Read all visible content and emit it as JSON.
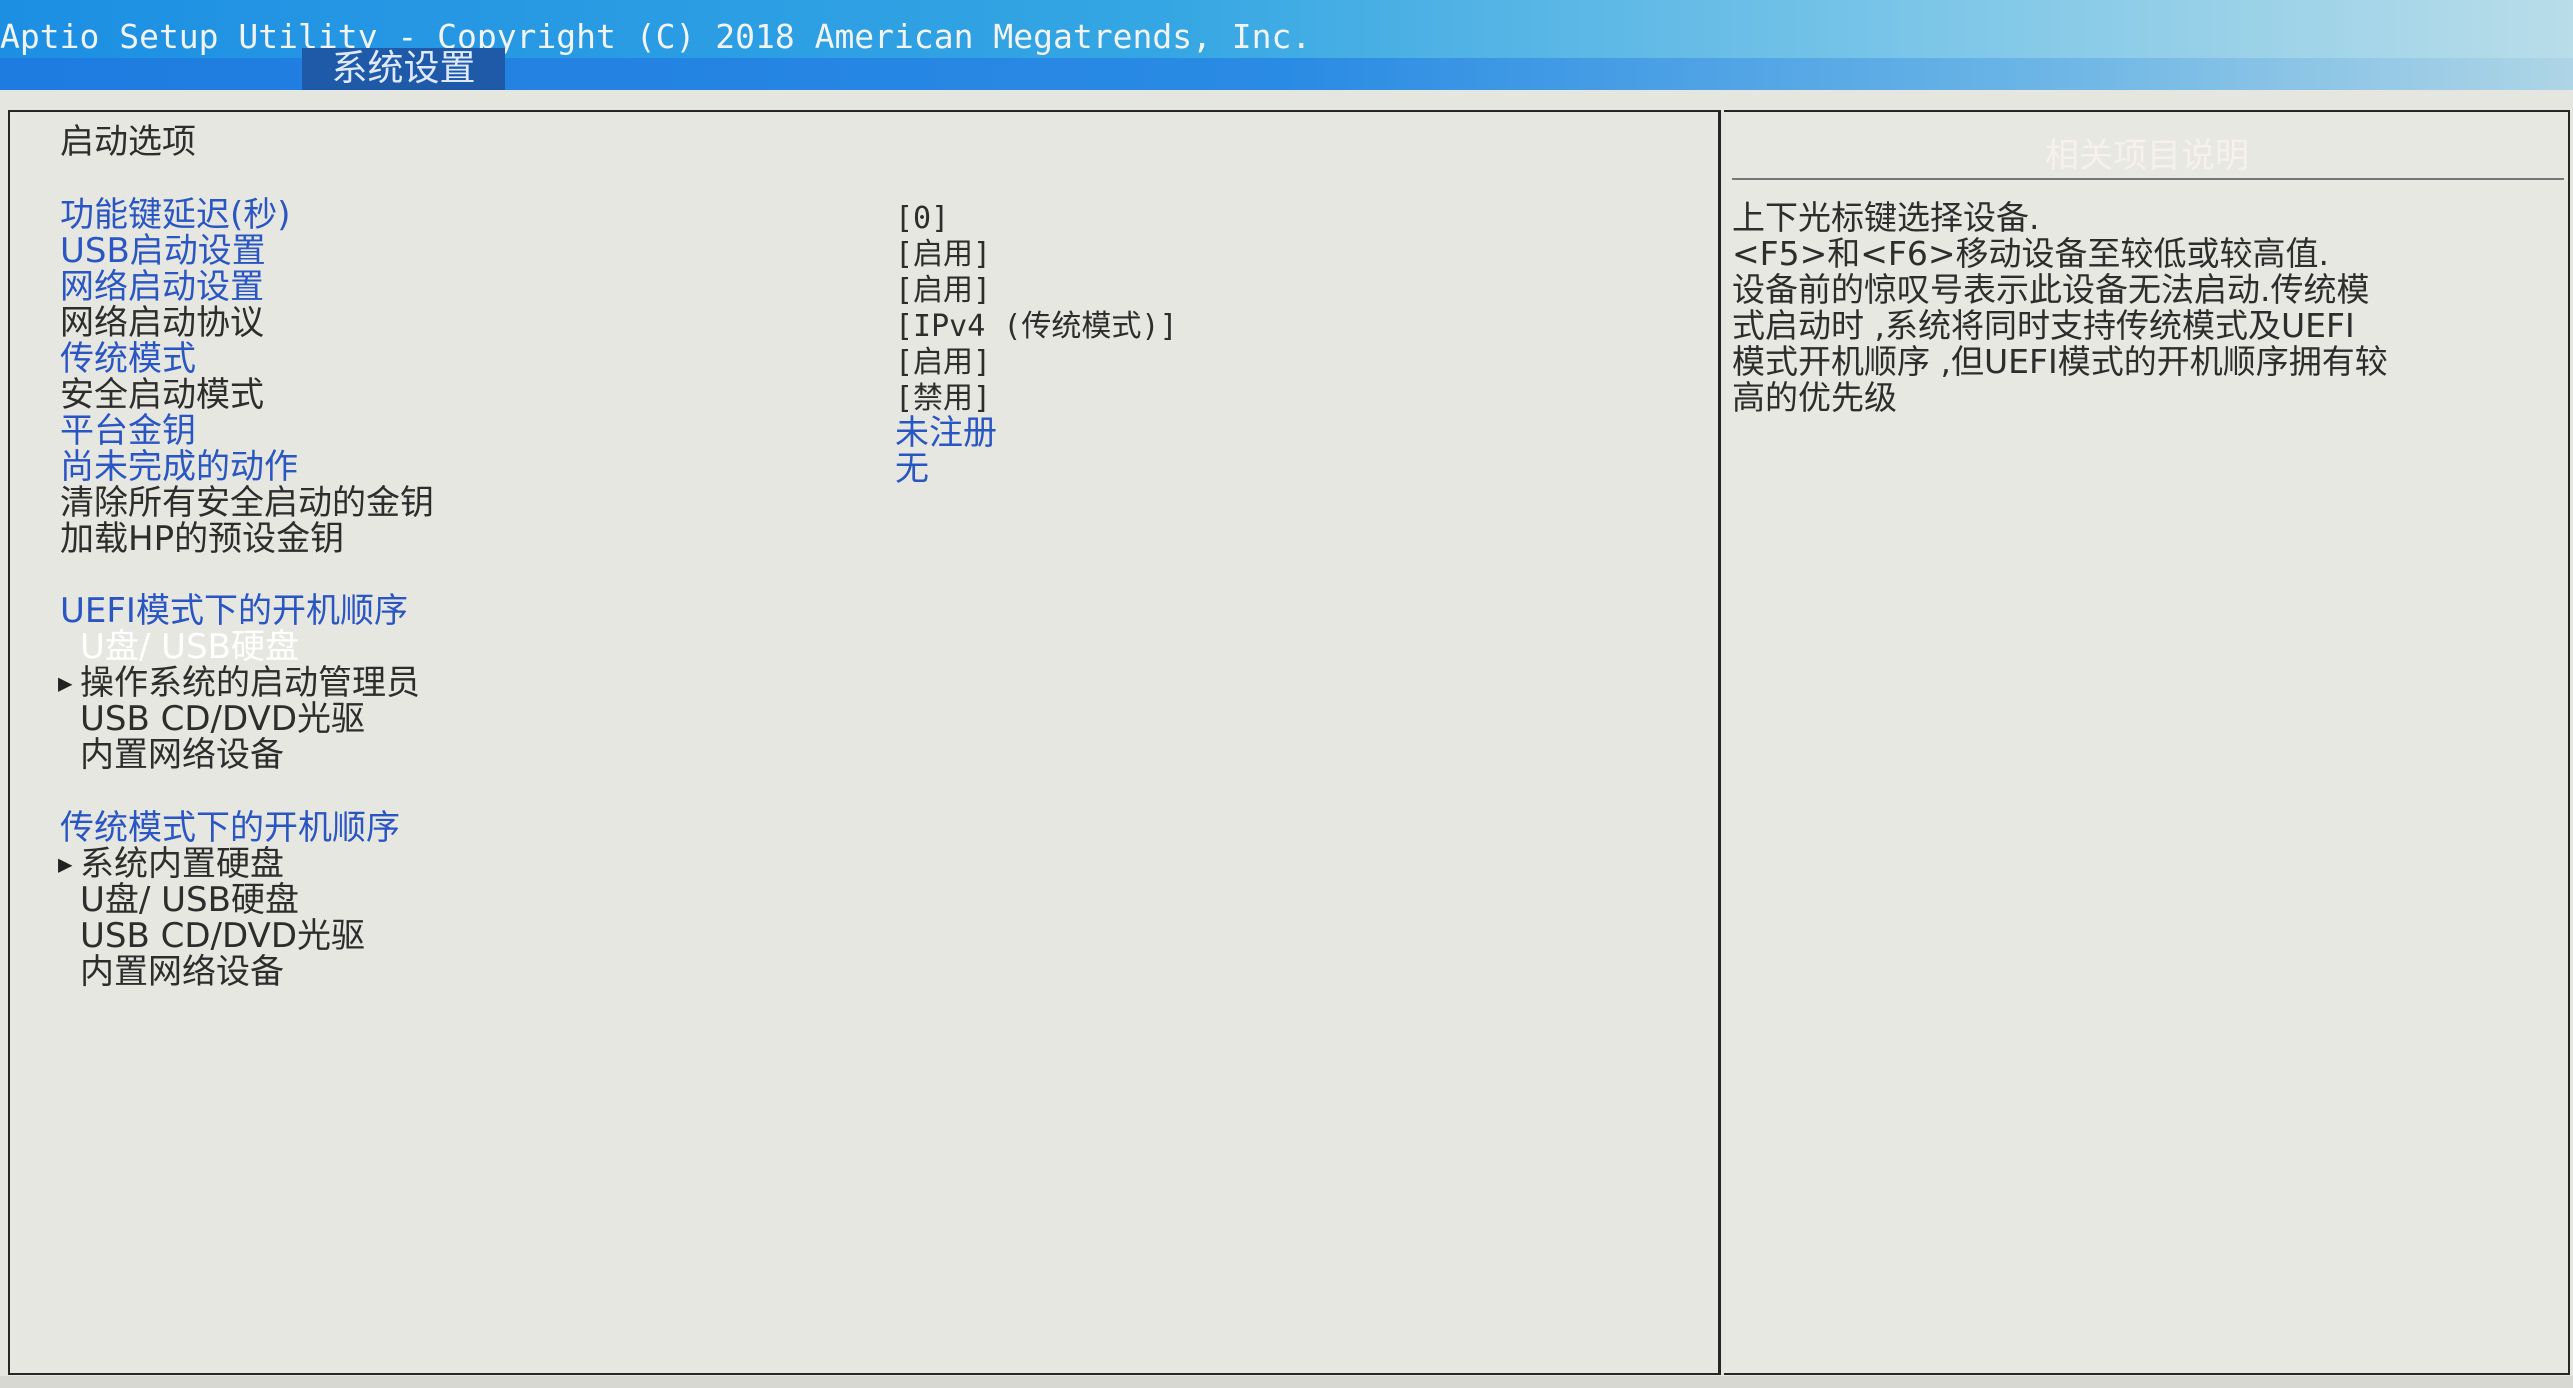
{
  "title": "Aptio Setup Utility - Copyright (C) 2018 American Megatrends, Inc.",
  "tab": "系统设置",
  "section_title": "启动选项",
  "settings": [
    {
      "label": "功能键延迟(秒)",
      "value": "[0]"
    },
    {
      "label": "USB启动设置",
      "value": "[启用]"
    },
    {
      "label": "网络启动设置",
      "value": "[启用]"
    },
    {
      "label": "网络启动协议",
      "value": "[IPv4 (传统模式)]"
    },
    {
      "label": "传统模式",
      "value": "[启用]"
    },
    {
      "label": "安全启动模式",
      "value": "[禁用]"
    },
    {
      "label": "平台金钥",
      "value": "未注册"
    },
    {
      "label": "尚未完成的动作",
      "value": "无"
    },
    {
      "label": "清除所有安全启动的金钥"
    },
    {
      "label": "加载HP的预设金钥"
    }
  ],
  "uefi_boot": {
    "heading": "UEFI模式下的开机顺序",
    "items": [
      "U盘/ USB硬盘",
      "操作系统的启动管理员",
      "USB CD/DVD光驱",
      "内置网络设备"
    ]
  },
  "legacy_boot": {
    "heading": "传统模式下的开机顺序",
    "items": [
      "系统内置硬盘",
      "U盘/ USB硬盘",
      "USB CD/DVD光驱",
      "内置网络设备"
    ]
  },
  "help": {
    "title": "相关项目说明",
    "lines": [
      "上下光标键选择设备.",
      "<F5>和<F6>移动设备至较低或较高值.",
      "设备前的惊叹号表示此设备无法启动.传统模",
      "式启动时 ,系统将同时支持传统模式及UEFI",
      "模式开机顺序 ,但UEFI模式的开机顺序拥有较",
      "高的优先级"
    ]
  },
  "colors": {
    "link_blue": "#2a56c4",
    "tab_bg": "#1e5aa8",
    "title_bar": "#1d8fe3",
    "panel_bg": "#e7e7e1"
  }
}
